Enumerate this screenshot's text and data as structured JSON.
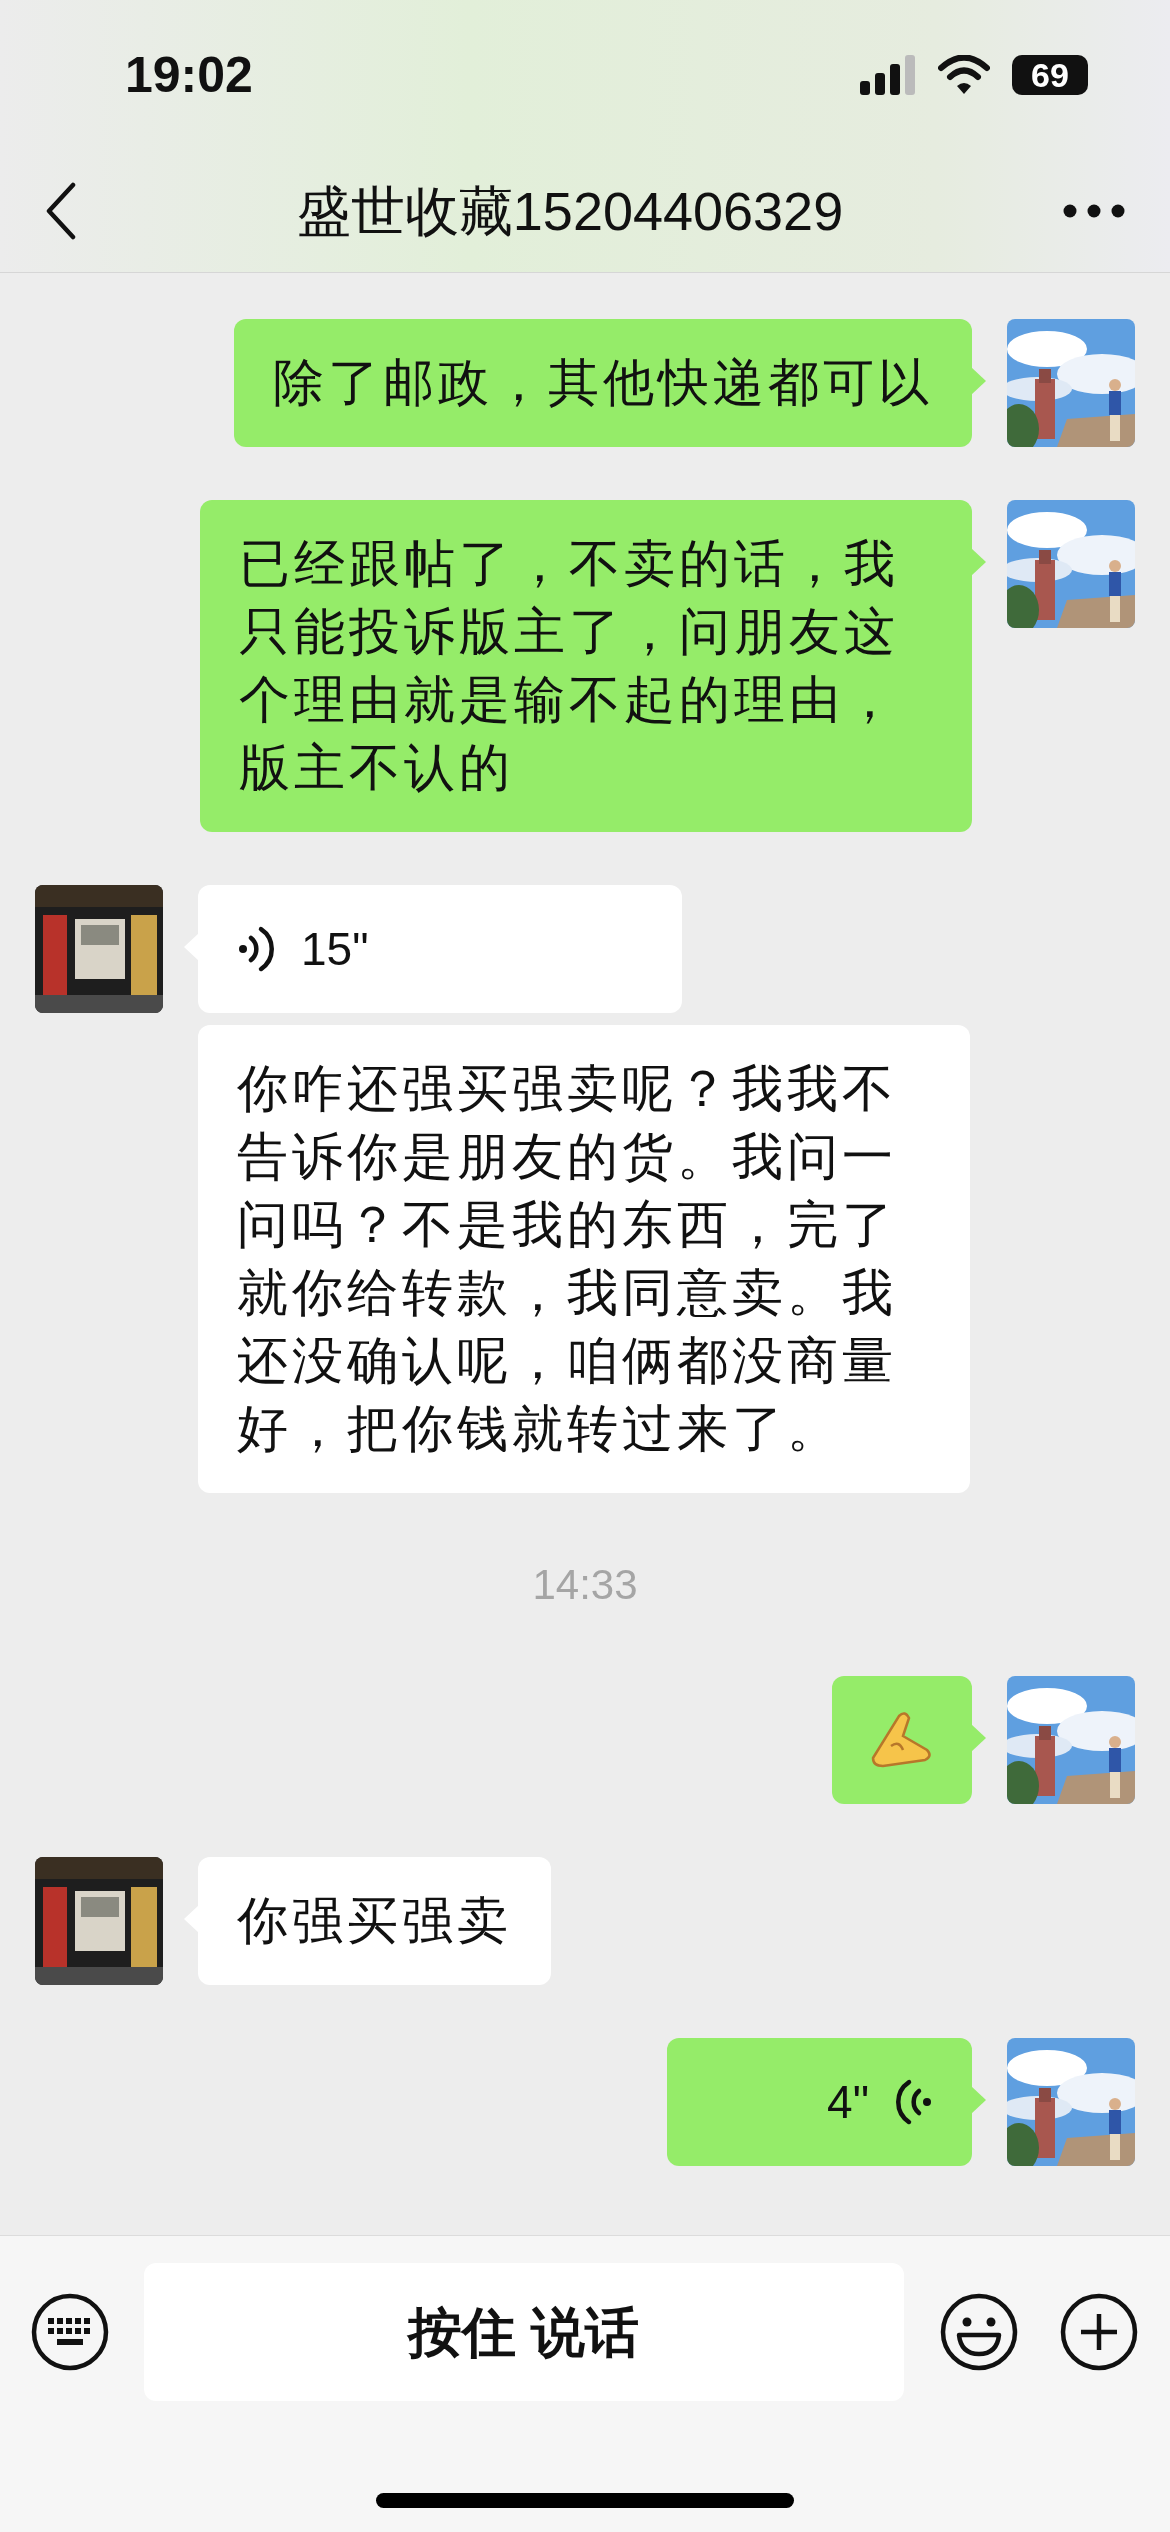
{
  "status_bar": {
    "time": "19:02",
    "battery": "69"
  },
  "header": {
    "title": "盛世收藏15204406329"
  },
  "messages": [
    {
      "kind": "text",
      "from_me": true,
      "text": "除了邮政，其他快递都可以"
    },
    {
      "kind": "text",
      "from_me": true,
      "text": "已经跟帖了，不卖的话，我只能投诉版主了，问朋友这个理由就是输不起的理由，版主不认的"
    },
    {
      "kind": "voice",
      "from_me": false,
      "duration": "15\""
    },
    {
      "kind": "text",
      "from_me": false,
      "grouped": true,
      "text": "你咋还强买强卖呢？我我不告诉你是朋友的货。我问一问吗？不是我的东西，完了就你给转款，我同意卖。我还没确认呢，咱俩都没商量好，把你钱就转过来了。"
    },
    {
      "kind": "time",
      "text": "14:33"
    },
    {
      "kind": "sticker",
      "from_me": true
    },
    {
      "kind": "text",
      "from_me": false,
      "text": "你强买强卖"
    },
    {
      "kind": "voice",
      "from_me": true,
      "duration": "4\""
    }
  ],
  "input_bar": {
    "hold_to_talk": "按住 说话"
  }
}
